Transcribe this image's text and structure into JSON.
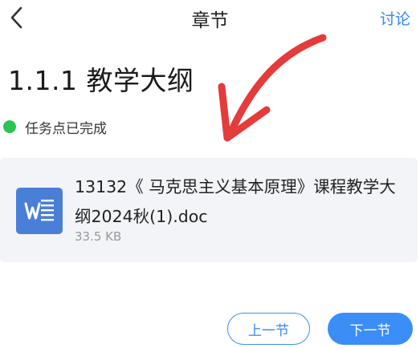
{
  "nav": {
    "back_icon": "chevron-left-icon",
    "title": "章节",
    "discuss_label": "讨论"
  },
  "chapter": {
    "title": "1.1.1 教学大纲"
  },
  "task": {
    "status_label": "任务点已完成",
    "status_color": "#2cc451"
  },
  "attachment": {
    "icon": "word-document-icon",
    "name": "13132《 马克思主义基本原理》课程教学大纲2024秋(1).doc",
    "size": "33.5 KB"
  },
  "annotation": {
    "icon": "red-arrow-icon",
    "color": "#e53b3b"
  },
  "footer": {
    "prev_label": "上一节",
    "next_label": "下一节"
  },
  "colors": {
    "accent": "#2f86f6",
    "card_bg": "#f3f4f7"
  }
}
